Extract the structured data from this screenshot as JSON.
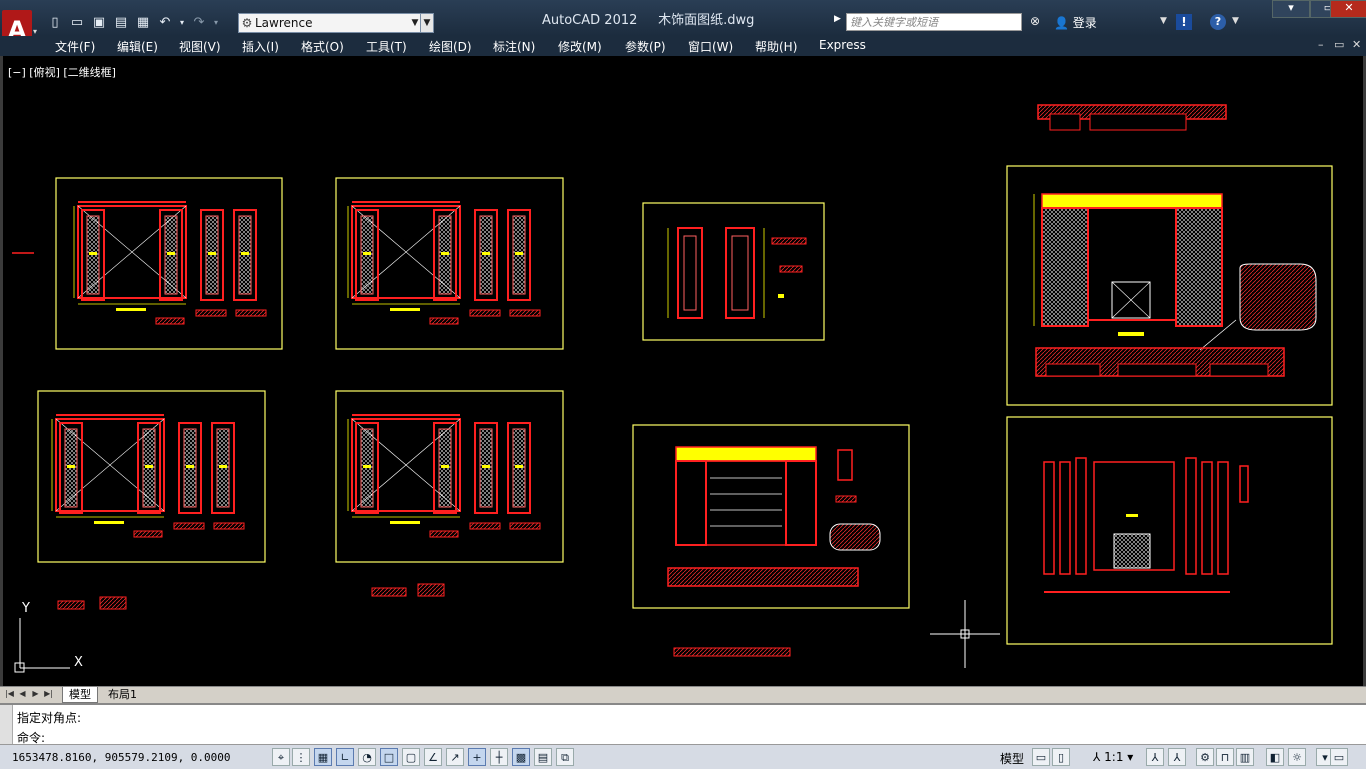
{
  "app": {
    "title": "AutoCAD 2012",
    "filename": "木饰面图纸.dwg",
    "workspace": "Lawrence"
  },
  "search": {
    "placeholder": "键入关键字或短语"
  },
  "user": {
    "login_label": "登录"
  },
  "menu": [
    "文件(F)",
    "编辑(E)",
    "视图(V)",
    "插入(I)",
    "格式(O)",
    "工具(T)",
    "绘图(D)",
    "标注(N)",
    "修改(M)",
    "参数(P)",
    "窗口(W)",
    "帮助(H)",
    "Express"
  ],
  "viewport": {
    "label": "[−] [俯视] [二维线框]"
  },
  "ucs": {
    "x": "X",
    "y": "Y"
  },
  "layout_tabs": [
    "模型",
    "布局1"
  ],
  "command": {
    "history": "指定对角点:",
    "prompt": "命令:"
  },
  "status": {
    "coords": "1653478.8160,  905579.2109,  0.0000",
    "model_label": "模型",
    "annotation_scale": "1:1"
  },
  "colors": {
    "frame": "#ffff66",
    "red": "#ff2020",
    "yellow": "#ffff00",
    "white": "#ffffff"
  }
}
